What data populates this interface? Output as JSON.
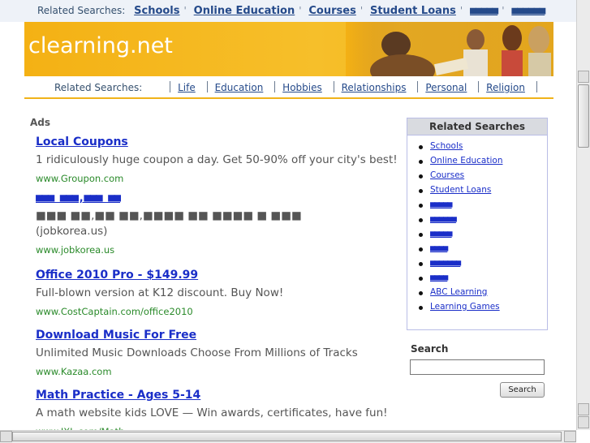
{
  "top_bar": {
    "label": "Related Searches:",
    "links": [
      "Schools",
      "Online Education",
      "Courses",
      "Student Loans",
      "■■■■■",
      "■■■■■■"
    ]
  },
  "banner": {
    "site_title": "clearning.net"
  },
  "nav": {
    "label": "Related Searches:",
    "links": [
      "Life",
      "Education",
      "Hobbies",
      "Relationships",
      "Personal",
      "Religion"
    ]
  },
  "ads": {
    "label": "Ads",
    "items": [
      {
        "title": "Local Coupons",
        "desc": "1 ridiculously huge coupon a day. Get 50-90% off your city's best!",
        "url": "www.Groupon.com"
      },
      {
        "title": "■■■ ■■■,■■■ ■■",
        "desc": "■■■ ■■,■■ ■■,■■■■ ■■ ■■■■ ■ ■■■\n(jobkorea.us)",
        "url": "www.jobkorea.us"
      },
      {
        "title": "Office 2010 Pro - $149.99",
        "desc": "Full-blown version at K12 discount. Buy Now!",
        "url": "www.CostCaptain.com/office2010"
      },
      {
        "title": "Download Music For Free",
        "desc": "Unlimited Music Downloads Choose From Millions of Tracks",
        "url": "www.Kazaa.com"
      },
      {
        "title": "Math Practice - Ages 5-14",
        "desc": "A math website kids LOVE — Win awards, certificates, have fun!",
        "url": "www.IXL.com/Math"
      }
    ]
  },
  "sidebar": {
    "heading": "Related Searches",
    "items": [
      "Schools",
      "Online Education",
      "Courses",
      "Student Loans",
      "■■■■■",
      "■■■■■■",
      "■■■■■",
      "■■■■",
      "■■■■■■■",
      "■■■■",
      "ABC Learning",
      "Learning Games"
    ]
  },
  "search": {
    "label": "Search",
    "button": "Search",
    "value": ""
  },
  "colors": {
    "banner": "#f4b114",
    "link": "#1a2ec8",
    "url_green": "#2a8a2a",
    "nav_link": "#254a8a"
  }
}
